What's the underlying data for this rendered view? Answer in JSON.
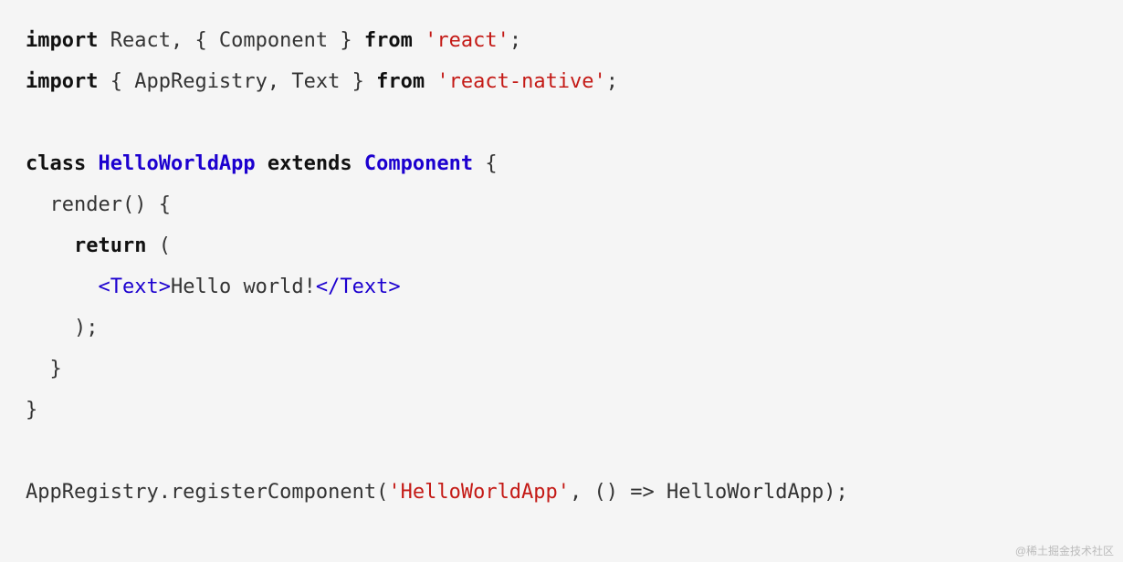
{
  "code": {
    "line1": {
      "kw_import": "import",
      "ident_react": " React, { Component } ",
      "kw_from": "from",
      "sp1": " ",
      "str_react": "'react'",
      "semi": ";"
    },
    "line2": {
      "kw_import": "import",
      "ident_rn": " { AppRegistry, Text } ",
      "kw_from": "from",
      "sp1": " ",
      "str_rn": "'react-native'",
      "semi": ";"
    },
    "line4": {
      "kw_class": "class",
      "sp1": " ",
      "cls_name": "HelloWorldApp",
      "sp2": " ",
      "kw_extends": "extends",
      "sp3": " ",
      "cls_super": "Component",
      "brace": " {"
    },
    "line5": "  render() {",
    "line6": {
      "indent": "    ",
      "kw_return": "return",
      "rest": " ("
    },
    "line7": {
      "indent": "      ",
      "tag_open": "<Text>",
      "content": "Hello world!",
      "tag_close": "</Text>"
    },
    "line8": "    );",
    "line9": "  }",
    "line10": "}",
    "line12": {
      "prefix": "AppRegistry.registerComponent(",
      "str_arg": "'HelloWorldApp'",
      "suffix": ", () => HelloWorldApp);"
    }
  },
  "watermark": "@稀土掘金技术社区"
}
